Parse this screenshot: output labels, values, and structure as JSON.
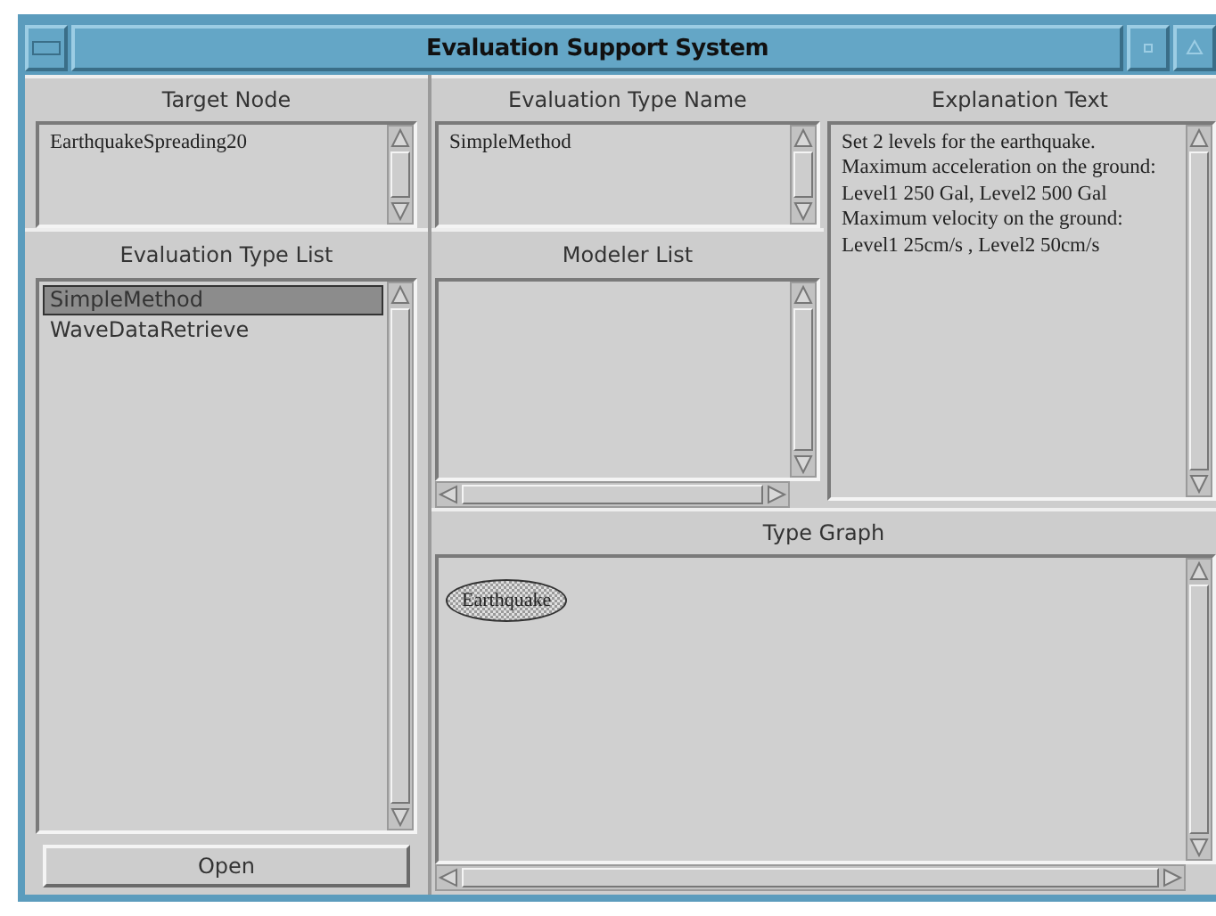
{
  "window": {
    "title": "Evaluation Support System"
  },
  "target_node": {
    "label": "Target Node",
    "value": "EarthquakeSpreading20"
  },
  "evaluation_type_name": {
    "label": "Evaluation Type Name",
    "value": "SimpleMethod"
  },
  "explanation": {
    "label": "Explanation Text",
    "paragraphs": [
      "Set 2 levels for the earthquake.",
      "Maximum acceleration on the ground:",
      "Level1 250 Gal, Level2 500 Gal",
      "Maximum velocity on the ground:",
      "Level1 25cm/s , Level2 50cm/s"
    ]
  },
  "evaluation_type_list": {
    "label": "Evaluation Type List",
    "items": [
      {
        "label": "SimpleMethod",
        "selected": true
      },
      {
        "label": "WaveDataRetrieve",
        "selected": false
      }
    ]
  },
  "modeler_list": {
    "label": "Modeler List"
  },
  "type_graph": {
    "label": "Type Graph",
    "nodes": [
      {
        "label": "Earthquake"
      }
    ]
  },
  "open_button": {
    "label": "Open"
  }
}
